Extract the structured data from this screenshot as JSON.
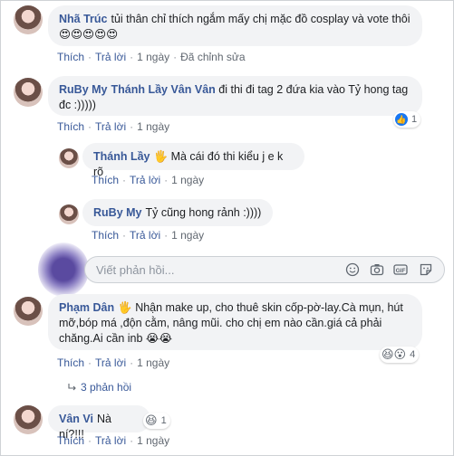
{
  "actions": {
    "like": "Thích",
    "reply": "Trả lời",
    "edited": "Đã chỉnh sửa"
  },
  "comments": [
    {
      "name": "Nhã Trúc",
      "text": "tủi thân chỉ thích ngắm mấy chị mặc đồ cosplay và vote thôi",
      "emoji": "😍😍😍😍😍",
      "time": "1 ngày"
    },
    {
      "name": "RuBy My",
      "tag": "Thánh Lầy Vân Vân",
      "text": "đi thi đi tag 2 đứa kia vào Tỷ hong tag đc :)))))",
      "time": "1 ngày",
      "reactions": {
        "count": "1"
      }
    },
    {
      "name": "Thánh Lầy",
      "hand": "🖐",
      "text": "Mà cái đó thi kiểu j e k rõ",
      "time": "1 ngày"
    },
    {
      "name": "RuBy My",
      "text": "Tỷ cũng hong rảnh :))))",
      "time": "1 ngày"
    },
    {
      "name": "Phạm Dân",
      "hand": "🖐",
      "text": "Nhận make up, cho thuê skin cốp-pờ-lay.Cà mụn, hút mỡ,bóp má ,độn cằm, nâng mũi. cho chị em nào cần.giá cả phải chăng.Ai cần inb",
      "emoji": "😭😭",
      "time": "1 ngày",
      "reactions": {
        "emoji": "😆😮",
        "count": "4"
      }
    },
    {
      "name": "Vân Vi",
      "text": "Nà ní?!!!",
      "time": "1 ngày",
      "reactions": {
        "emoji": "😆",
        "count": "1"
      }
    }
  ],
  "reply_input": {
    "placeholder": "Viết phản hồi..."
  },
  "replies_link": "3 phản hồi",
  "icons": [
    "smiley-icon",
    "camera-icon",
    "gif-icon",
    "sticker-icon",
    "reply-arrow-icon",
    "like-icon"
  ],
  "colors": {
    "link": "#385898",
    "bubble": "#f2f3f5",
    "meta": "#606770",
    "like_blue": "#1877f2"
  }
}
